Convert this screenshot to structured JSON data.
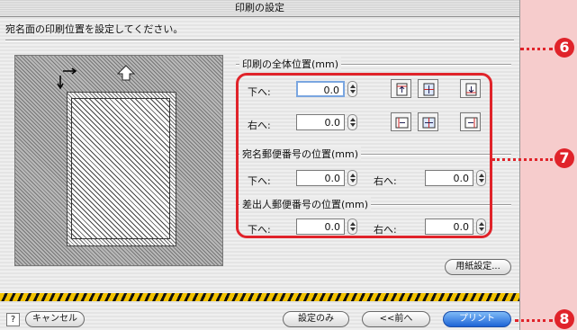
{
  "window": {
    "title": "印刷の設定"
  },
  "instruction": "宛名面の印刷位置を設定してください。",
  "group_overall": {
    "title": "印刷の全体位置(mm)"
  },
  "overall": {
    "down_label": "下へ:",
    "down_value": "0.0",
    "right_label": "右へ:",
    "right_value": "0.0"
  },
  "group_recipient": {
    "title": "宛名郵便番号の位置(mm)"
  },
  "recipient": {
    "down_label": "下へ:",
    "down_value": "0.0",
    "right_label": "右へ:",
    "right_value": "0.0"
  },
  "group_sender": {
    "title": "差出人郵便番号の位置(mm)"
  },
  "sender": {
    "down_label": "下へ:",
    "down_value": "0.0",
    "right_label": "右へ:",
    "right_value": "0.0"
  },
  "buttons": {
    "paper_setup": "用紙設定...",
    "help": "?",
    "cancel": "キャンセル",
    "settings_only": "設定のみ",
    "back": "<<前へ",
    "print": "プリント"
  },
  "callouts": {
    "c6": "6",
    "c7": "7",
    "c8": "8"
  },
  "colors": {
    "callout_red": "#e0232a",
    "primary_blue": "#1d64d6"
  }
}
